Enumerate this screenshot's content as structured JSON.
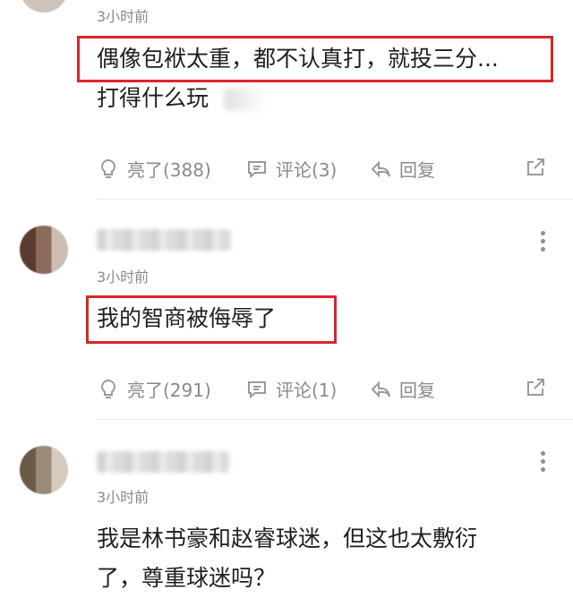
{
  "comments": [
    {
      "time": "3小时前",
      "text_line1": "偶像包袱太重，都不认真打，就投三分...",
      "text_line2": "打得什么玩",
      "actions": {
        "like": "亮了(388)",
        "comment": "评论(3)",
        "reply": "回复"
      }
    },
    {
      "time": "3小时前",
      "text_line1": "我的智商被侮辱了",
      "actions": {
        "like": "亮了(291)",
        "comment": "评论(1)",
        "reply": "回复"
      }
    },
    {
      "time": "3小时前",
      "text_line1": "我是林书豪和赵睿球迷，但这也太敷衍",
      "text_line2": "了，尊重球迷吗？"
    }
  ],
  "colors": {
    "highlight": "#d9262b",
    "meta": "#8a8a8a",
    "text": "#1f1f1f"
  },
  "icons": [
    "lightbulb-icon",
    "comment-icon",
    "reply-icon",
    "share-icon",
    "more-vertical-icon"
  ]
}
